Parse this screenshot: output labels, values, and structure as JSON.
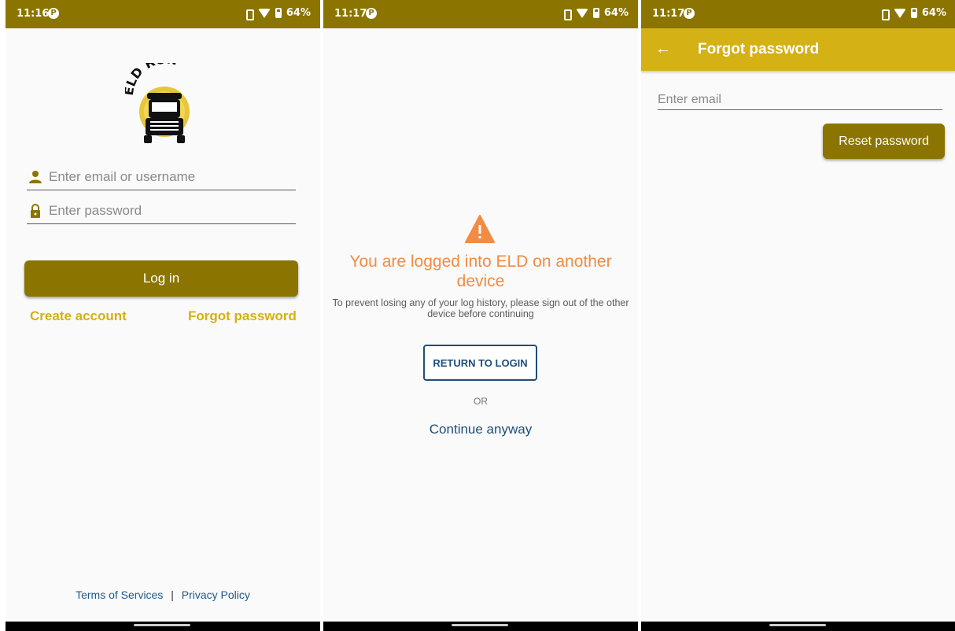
{
  "status_bars": [
    {
      "time": "11:16",
      "battery": "64%"
    },
    {
      "time": "11:17",
      "battery": "64%"
    },
    {
      "time": "11:17",
      "battery": "64%"
    }
  ],
  "login": {
    "logo_text": "ELD RUN",
    "email_placeholder": "Enter email or username",
    "password_placeholder": "Enter password",
    "login_label": "Log in",
    "create_account": "Create account",
    "forgot_password": "Forgot password",
    "terms": "Terms of Services",
    "separator": "|",
    "privacy": "Privacy Policy"
  },
  "other_device": {
    "title": "You are logged into ELD on another device",
    "message": "To prevent losing any of your log history, please sign out of the other device before continuing",
    "return_label": "RETURN TO LOGIN",
    "or_label": "OR",
    "continue_label": "Continue anyway"
  },
  "forgot": {
    "title": "Forgot password",
    "email_placeholder": "Enter email",
    "reset_label": "Reset password"
  },
  "colors": {
    "status_bar": "#8b7500",
    "app_bar": "#d4b114",
    "primary_button": "#8b7500",
    "gold_link": "#d4b10e",
    "warning": "#f28b43",
    "blue_link": "#1e4e79"
  },
  "icons": [
    "person-icon",
    "lock-icon",
    "warning-icon",
    "back-arrow-icon",
    "wifi-icon",
    "battery-icon",
    "vibrate-icon"
  ]
}
